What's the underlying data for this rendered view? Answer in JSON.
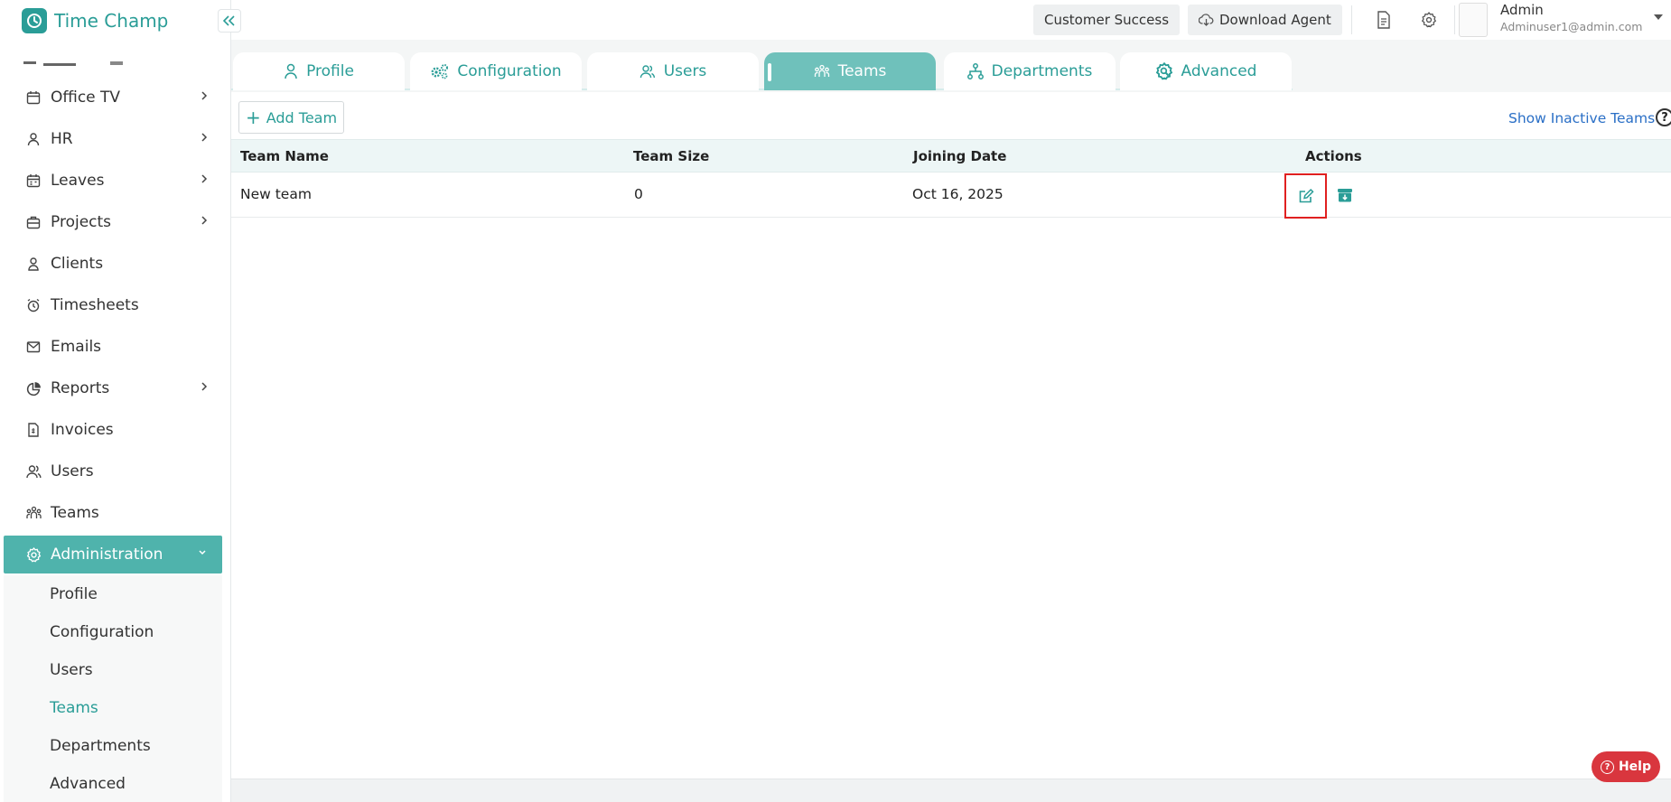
{
  "app": {
    "name": "Time Champ",
    "accent": "#2a9d97",
    "active_bg": "#4fb3ac"
  },
  "sidebar": {
    "items": [
      {
        "label": "Office TV",
        "icon": "calendar-icon",
        "has_submenu": true
      },
      {
        "label": "HR",
        "icon": "person-icon",
        "has_submenu": true
      },
      {
        "label": "Leaves",
        "icon": "calendar-icon",
        "has_submenu": true
      },
      {
        "label": "Projects",
        "icon": "briefcase-icon",
        "has_submenu": true
      },
      {
        "label": "Clients",
        "icon": "person-icon",
        "has_submenu": false
      },
      {
        "label": "Timesheets",
        "icon": "alarm-icon",
        "has_submenu": false
      },
      {
        "label": "Emails",
        "icon": "mail-icon",
        "has_submenu": false
      },
      {
        "label": "Reports",
        "icon": "pie-chart-icon",
        "has_submenu": true
      },
      {
        "label": "Invoices",
        "icon": "invoice-icon",
        "has_submenu": false
      },
      {
        "label": "Users",
        "icon": "users-icon",
        "has_submenu": false
      },
      {
        "label": "Teams",
        "icon": "team-icon",
        "has_submenu": false
      }
    ],
    "active": {
      "label": "Administration",
      "icon": "gear-icon"
    },
    "subitems": [
      {
        "label": "Profile",
        "current": false
      },
      {
        "label": "Configuration",
        "current": false
      },
      {
        "label": "Users",
        "current": false
      },
      {
        "label": "Teams",
        "current": true
      },
      {
        "label": "Departments",
        "current": false
      },
      {
        "label": "Advanced",
        "current": false
      }
    ]
  },
  "topbar": {
    "customer_success": "Customer Success",
    "download_agent": "Download Agent",
    "user": {
      "name": "Admin",
      "email": "Adminuser1@admin.com"
    }
  },
  "tabs": [
    {
      "label": "Profile",
      "icon": "person-icon",
      "active": false
    },
    {
      "label": "Configuration",
      "icon": "gears-icon",
      "active": false
    },
    {
      "label": "Users",
      "icon": "users-icon",
      "active": false
    },
    {
      "label": "Teams",
      "icon": "team-icon",
      "active": true
    },
    {
      "label": "Departments",
      "icon": "org-chart-icon",
      "active": false
    },
    {
      "label": "Advanced",
      "icon": "advanced-gear-icon",
      "active": false
    }
  ],
  "toolbar": {
    "add_team": "Add Team",
    "show_inactive": "Show Inactive Teams"
  },
  "table": {
    "columns": [
      "Team Name",
      "Team Size",
      "Joining Date",
      "Actions"
    ],
    "rows": [
      {
        "team_name": "New team",
        "team_size": "0",
        "joining_date": "Oct 16, 2025"
      }
    ]
  },
  "help": {
    "label": "Help"
  }
}
